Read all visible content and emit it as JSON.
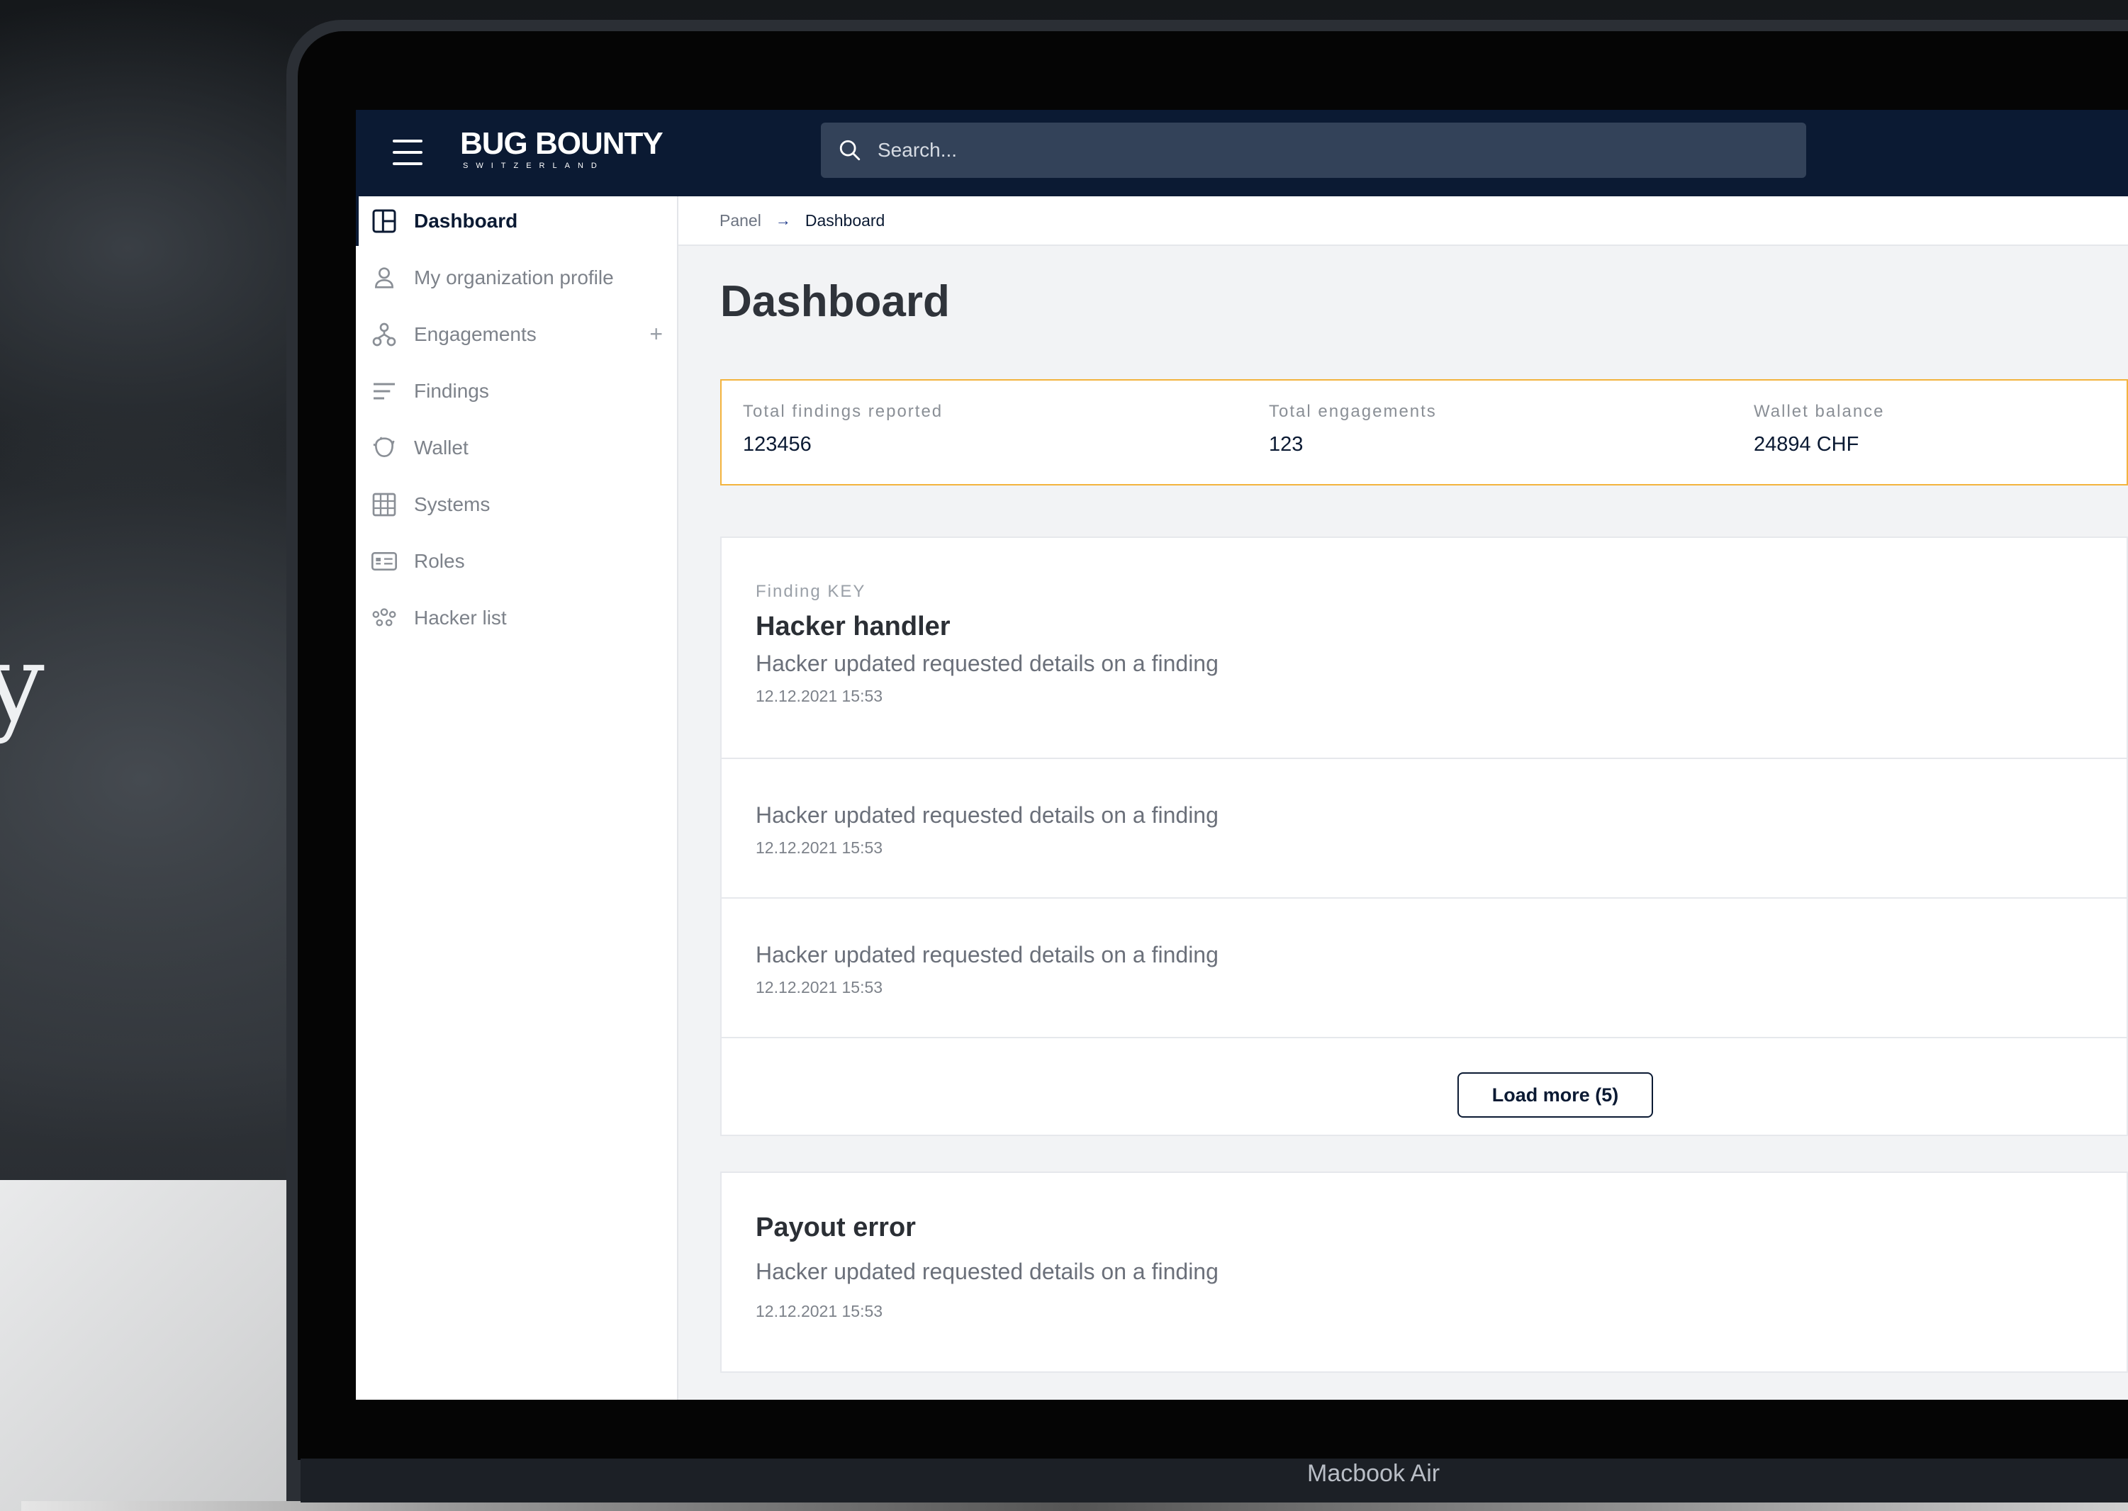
{
  "device_label": "Macbook Air",
  "background": {
    "letter": "y"
  },
  "brand": {
    "name": "BUG BOUNTY",
    "sub": "SWITZERLAND"
  },
  "search": {
    "placeholder": "Search..."
  },
  "sidebar": {
    "items": [
      {
        "label": "Dashboard",
        "icon": "dashboard-icon",
        "active": true
      },
      {
        "label": "My organization profile",
        "icon": "user-icon"
      },
      {
        "label": "Engagements",
        "icon": "engagements-icon",
        "action": "+"
      },
      {
        "label": "Findings",
        "icon": "findings-icon"
      },
      {
        "label": "Wallet",
        "icon": "wallet-icon"
      },
      {
        "label": "Systems",
        "icon": "grid-icon"
      },
      {
        "label": "Roles",
        "icon": "id-card-icon"
      },
      {
        "label": "Hacker list",
        "icon": "people-icon"
      }
    ]
  },
  "breadcrumb": {
    "items": [
      "Panel",
      "Dashboard"
    ],
    "separator": "→"
  },
  "page": {
    "title": "Dashboard"
  },
  "stats": [
    {
      "label": "Total findings reported",
      "value": "123456"
    },
    {
      "label": "Total engagements",
      "value": "123"
    },
    {
      "label": "Wallet balance",
      "value": "24894 CHF"
    }
  ],
  "feed": {
    "key_label": "Finding KEY",
    "title": "Hacker handler",
    "items": [
      {
        "text": "Hacker updated requested details on a finding",
        "time": "12.12.2021 15:53"
      },
      {
        "text": "Hacker updated requested details on a finding",
        "time": "12.12.2021 15:53"
      },
      {
        "text": "Hacker updated requested details on a finding",
        "time": "12.12.2021 15:53"
      }
    ],
    "load_more_label": "Load more (5)"
  },
  "payout": {
    "title": "Payout error",
    "text": "Hacker updated requested details on a finding",
    "time": "12.12.2021 15:53"
  },
  "colors": {
    "navy": "#0b1a33",
    "accent_border": "#f3b33d",
    "search_bg": "#334259"
  }
}
